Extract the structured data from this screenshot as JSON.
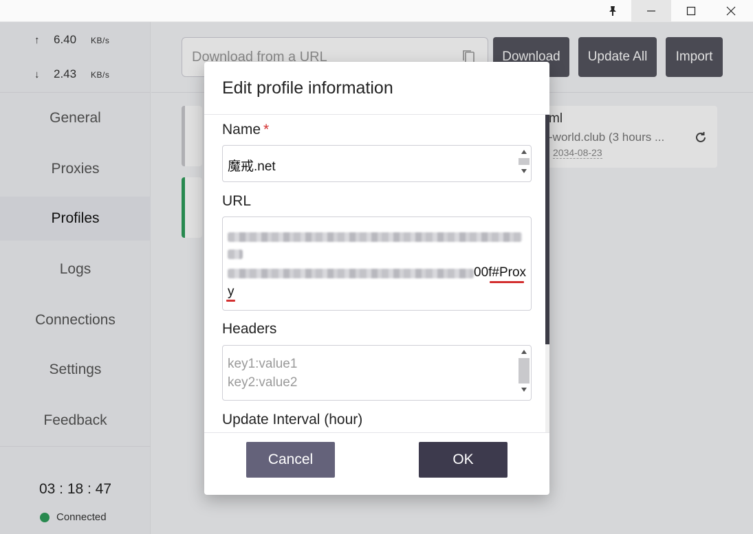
{
  "titlebar": {
    "icons": [
      "pin-icon",
      "minimize-icon",
      "maximize-icon",
      "close-icon"
    ]
  },
  "sidebar": {
    "upload_value": "6.40",
    "upload_unit": "KB/s",
    "download_value": "2.43",
    "download_unit": "KB/s",
    "up_arrow": "↑",
    "down_arrow": "↓",
    "items": [
      {
        "label": "General",
        "active": false
      },
      {
        "label": "Proxies",
        "active": false
      },
      {
        "label": "Profiles",
        "active": true
      },
      {
        "label": "Logs",
        "active": false
      },
      {
        "label": "Connections",
        "active": false
      },
      {
        "label": "Settings",
        "active": false
      },
      {
        "label": "Feedback",
        "active": false
      }
    ],
    "clock": "03 : 18 : 47",
    "status": "Connected",
    "status_color": "#2e9d5a"
  },
  "toolbar": {
    "url_placeholder": "Download from a URL",
    "download_label": "Download",
    "update_all_label": "Update All",
    "import_label": "Import"
  },
  "profile_cards": [
    {
      "title_fragment": "ml",
      "subtitle_fragment": "-world.club (3 hours ...",
      "date_fragment": "2034-08-23"
    }
  ],
  "dialog": {
    "title": "Edit profile information",
    "name_label": "Name",
    "required_mark": "*",
    "name_value": "魔戒.net",
    "url_label": "URL",
    "url_visible_tail": "00f#Prox",
    "url_visible_last": "y",
    "headers_label": "Headers",
    "headers_placeholder_line1": "key1:value1",
    "headers_placeholder_line2": "key2:value2",
    "interval_label": "Update Interval (hour)",
    "cancel_label": "Cancel",
    "ok_label": "OK"
  },
  "colors": {
    "accent_dark": "#3d3a4d",
    "cancel_button": "#64627a",
    "required": "#d32f2f",
    "connected": "#2e9d5a"
  }
}
